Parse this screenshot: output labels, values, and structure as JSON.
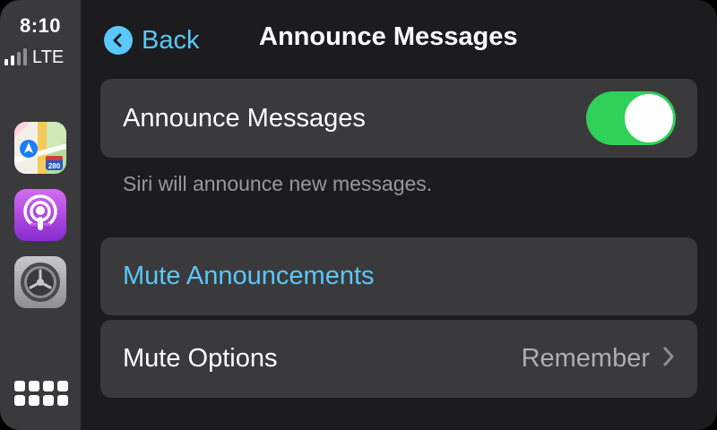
{
  "status": {
    "time": "8:10",
    "carrier": "LTE"
  },
  "sidebar": {
    "apps": [
      {
        "name": "Maps",
        "icon": "maps-app-icon",
        "shield_text": "280"
      },
      {
        "name": "Podcasts",
        "icon": "podcasts-app-icon"
      },
      {
        "name": "Settings",
        "icon": "settings-app-icon"
      }
    ],
    "home_icon": "app-grid-icon"
  },
  "header": {
    "back_label": "Back",
    "title": "Announce Messages"
  },
  "announce": {
    "label": "Announce Messages",
    "enabled": true,
    "footnote": "Siri will announce new messages."
  },
  "mute": {
    "label": "Mute Announcements"
  },
  "mute_options": {
    "label": "Mute Options",
    "value": "Remember"
  },
  "colors": {
    "accent": "#5ac8fa",
    "toggle_on": "#30d158",
    "cell_bg": "#3a3a3c",
    "screen_bg": "#1c1c1e"
  }
}
